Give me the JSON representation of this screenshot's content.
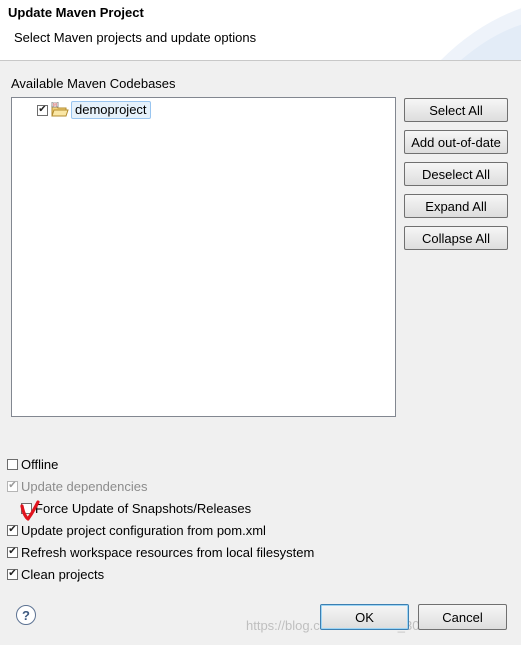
{
  "dialog": {
    "title": "Update Maven Project",
    "subtitle": "Select Maven projects and update options"
  },
  "codebases": {
    "group_label": "Available Maven Codebases",
    "items": [
      {
        "label": "demoproject",
        "checked": true,
        "icon": "maven-project-folder-icon"
      }
    ]
  },
  "side_buttons": {
    "select_all": "Select All",
    "add_out_of_date": "Add out-of-date",
    "deselect_all": "Deselect All",
    "expand_all": "Expand All",
    "collapse_all": "Collapse All"
  },
  "options": {
    "offline": {
      "label": "Offline",
      "checked": false
    },
    "update_dependencies": {
      "label": "Update dependencies",
      "checked": true,
      "disabled": true
    },
    "force_update": {
      "label": "Force Update of Snapshots/Releases",
      "checked": false
    },
    "update_config": {
      "label": "Update project configuration from pom.xml",
      "checked": true
    },
    "refresh_workspace": {
      "label": "Refresh workspace resources from local filesystem",
      "checked": true
    },
    "clean_projects": {
      "label": "Clean projects",
      "checked": true
    }
  },
  "footer": {
    "help_glyph": "?",
    "ok_label": "OK",
    "cancel_label": "Cancel",
    "watermark": "https://blog.csdn.net/baidu_30744225"
  },
  "colors": {
    "annotation_mark": "#e0141e",
    "selection_fill": "#e5f1fb",
    "default_button_border": "#3c7fb1"
  }
}
